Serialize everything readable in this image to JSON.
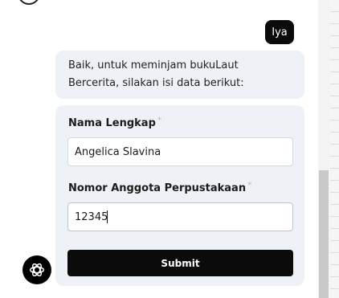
{
  "chat": {
    "user_message": "Iya",
    "bot_message": "Baik, untuk meminjam bukuLaut Bercerita, silakan isi data berikut:",
    "bot_message_line1": "Baik, untuk meminjam bukuLaut",
    "bot_message_line2": "Bercerita, silakan isi data berikut:"
  },
  "form": {
    "fields": [
      {
        "label": "Nama Lengkap",
        "required_mark": "*",
        "value": "Angelica Slavina"
      },
      {
        "label": "Nomor Anggota Perpustakaan",
        "required_mark": "*",
        "value": "12345"
      }
    ],
    "submit_label": "Submit"
  },
  "colors": {
    "bubble_user": "#0b0b0b",
    "bubble_bot": "#eef1f6",
    "button": "#0b0b0b"
  },
  "icons": {
    "bot_avatar": "openai-knot-icon",
    "top_avatar": "avatar-icon"
  }
}
